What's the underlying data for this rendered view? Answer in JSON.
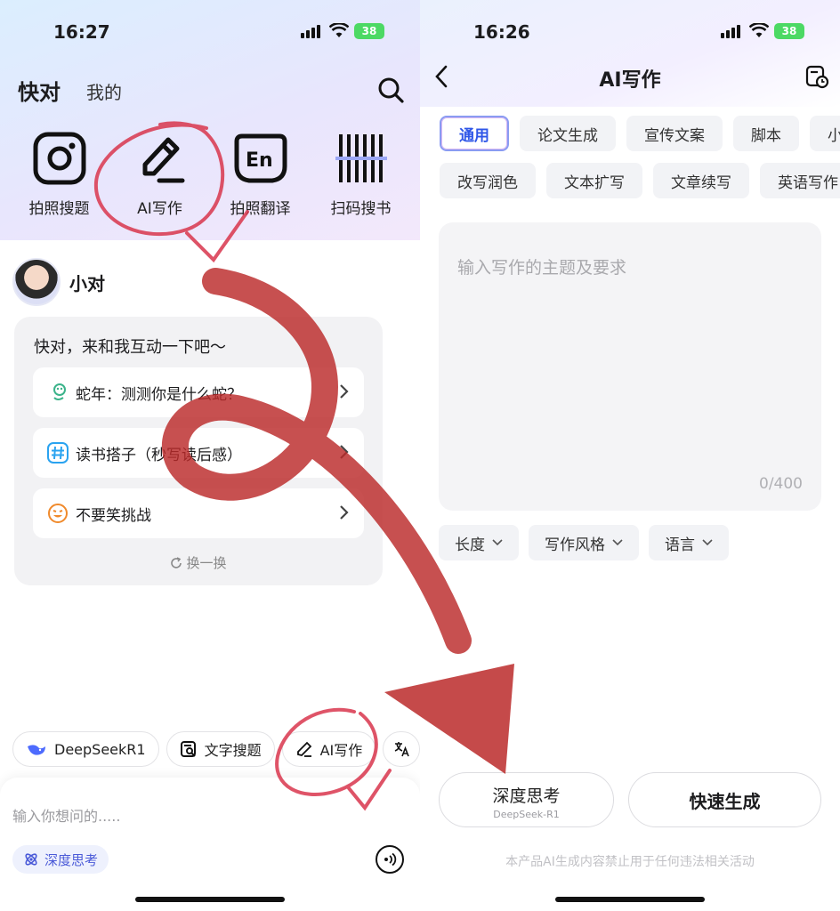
{
  "left": {
    "status": {
      "time": "16:27",
      "battery": "38"
    },
    "header": {
      "tab_active": "快对",
      "tab_other": "我的"
    },
    "tools": [
      {
        "label": "拍照搜题",
        "icon": "camera-icon"
      },
      {
        "label": "AI写作",
        "icon": "pen-icon"
      },
      {
        "label": "拍照翻译",
        "icon": "translate-en-icon"
      },
      {
        "label": "扫码搜书",
        "icon": "barcode-icon"
      }
    ],
    "bot": {
      "name": "小对"
    },
    "card": {
      "greeting": "快对，来和我互动一下吧～",
      "suggestions": [
        {
          "text": "蛇年：测测你是什么蛇？",
          "icon": "snake-icon",
          "color": "#3bb38a"
        },
        {
          "text": "读书搭子（秒写读后感）",
          "icon": "hashtag-icon",
          "color": "#2aa3f0"
        },
        {
          "text": "不要笑挑战",
          "icon": "laugh-icon",
          "color": "#f08a2c"
        }
      ],
      "refresh": "换一换"
    },
    "chips": [
      {
        "label": "DeepSeekR1",
        "icon": "whale-icon"
      },
      {
        "label": "文字搜题",
        "icon": "text-search-icon"
      },
      {
        "label": "AI写作",
        "icon": "pen-icon"
      }
    ],
    "input": {
      "placeholder": "输入你想问的.....",
      "deep_think": "深度思考"
    }
  },
  "right": {
    "status": {
      "time": "16:26",
      "battery": "38"
    },
    "title": "AI写作",
    "tabs_row1": [
      "通用",
      "论文生成",
      "宣传文案",
      "脚本",
      "小"
    ],
    "tabs_row2": [
      "改写润色",
      "文本扩写",
      "文章续写",
      "英语写作"
    ],
    "textbox": {
      "placeholder": "输入写作的主题及要求",
      "counter": "0/400"
    },
    "options": [
      "长度",
      "写作风格",
      "语言"
    ],
    "btn_deep": {
      "label": "深度思考",
      "sub": "DeepSeek-R1"
    },
    "btn_fast": "快速生成",
    "disclaimer": "本产品AI生成内容禁止用于任何违法相关活动"
  },
  "colors": {
    "accent": "#2f57e8",
    "annotation": "#c42b2b"
  }
}
